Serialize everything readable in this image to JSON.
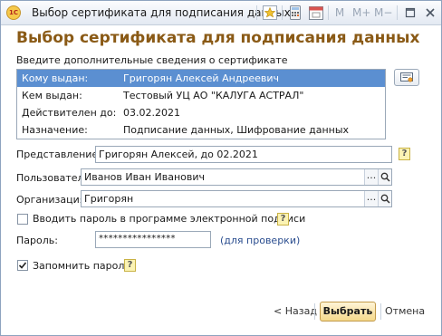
{
  "window": {
    "title": "Выбор сертификата для подписания данных",
    "app_icon_text": "1С",
    "toolbar": {
      "m": "M",
      "m_plus": "M+",
      "m_minus": "M−"
    }
  },
  "heading": "Выбор сертификата для подписания данных",
  "cert_info_label": "Введите дополнительные сведения о сертификате",
  "cert_rows": [
    {
      "key": "Кому выдан:",
      "value": "Григорян Алексей Андреевич"
    },
    {
      "key": "Кем выдан:",
      "value": "Тестовый УЦ АО \"КАЛУГА АСТРАЛ\""
    },
    {
      "key": "Действителен до:",
      "value": "03.02.2021"
    },
    {
      "key": "Назначение:",
      "value": "Подписание данных, Шифрование данных"
    }
  ],
  "fields": {
    "representation": {
      "label": "Представление:",
      "value": "Григорян Алексей, до 02.2021"
    },
    "user": {
      "label": "Пользователь:",
      "value": "Иванов Иван Иванович"
    },
    "organization": {
      "label": "Организация:",
      "value": "Григорян"
    },
    "password": {
      "label": "Пароль:",
      "value": "****************"
    }
  },
  "enter_password_checkbox": {
    "label": "Вводить пароль в программе электронной подписи",
    "checked": false
  },
  "check_link": "(для проверки)",
  "remember_password_checkbox": {
    "label": "Запомнить пароль",
    "checked": true
  },
  "help_glyph": "?",
  "ellipsis": "...",
  "buttons": {
    "back": "< Назад",
    "select": "Выбрать",
    "cancel": "Отмена"
  },
  "colors": {
    "heading": "#8a5a16",
    "selection": "#5b8fd1",
    "link": "#2a4d8f",
    "primary_button": "#f5d98c"
  }
}
